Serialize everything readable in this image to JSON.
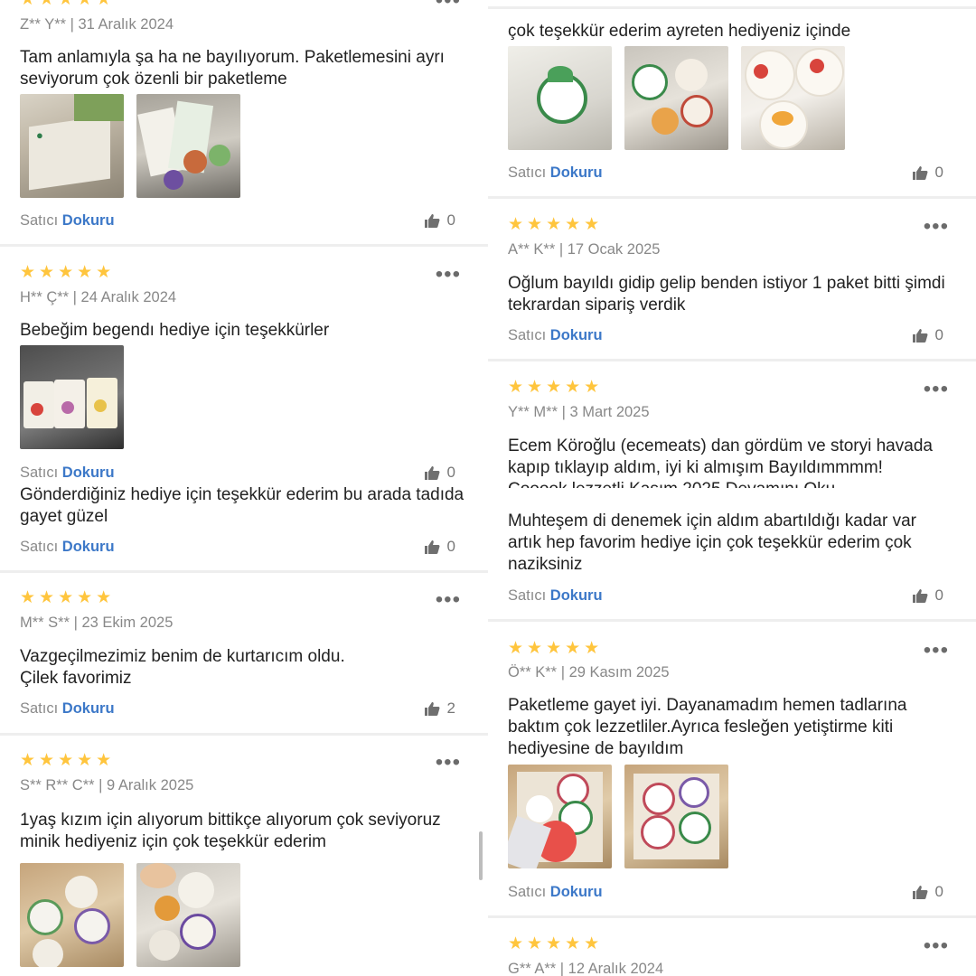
{
  "seller_prefix": "Satıcı",
  "seller_name": "Dokuru",
  "star_glyphs": "★★★★★",
  "more_glyph": "•••",
  "left": [
    {
      "author": "Z** Y** | 31 Aralık 2024",
      "text": "Tam anlamıyla şa ha ne bayılıyorum. Paketlemesini ayrı seviyorum çok özenli bir paketleme",
      "likes": "0",
      "photos": [
        "kraft box with deküru logo",
        "product pouches and stickers"
      ]
    },
    {
      "author": "H** Ç** | 24 Aralık 2024",
      "text": "Bebeğim begendı hediye için teşekkürler",
      "likes": "0",
      "photos": [
        "three fruit snack pouches"
      ]
    },
    {
      "author": "",
      "text": "Gönderdiğiniz hediye için teşekkür ederim bu arada tadıda gayet güzel",
      "likes": "0",
      "photos": []
    },
    {
      "author": "M** S** | 23 Ekim 2025",
      "text": "Vazgeçilmezimiz benim de kurtarıcım oldu. Çilek favorimiz",
      "likes": "2",
      "photos": []
    },
    {
      "author": "S** R** C** | 9 Aralık 2025",
      "text": "1yaş kızım için alıyorum bittikçe alıyorum çok seviyoruz minik hediyeniz için çok teşekkür ederim",
      "likes": "",
      "photos": [
        "box of snack cups",
        "hand holding snack cups"
      ]
    }
  ],
  "right": [
    {
      "author": "",
      "text": "çok teşekkür ederim ayreten hediyeniz içinde",
      "likes": "0",
      "photos": [
        "hediyecik fesleğen kit bag",
        "snack cups in bag",
        "çilek and mango cups"
      ]
    },
    {
      "author": "A** K** | 17 Ocak 2025",
      "text": "Oğlum bayıldı gidip gelip benden istiyor 1 paket bitti şimdi tekrardan sipariş verdik",
      "likes": "0",
      "photos": []
    },
    {
      "author": "Y** M** | 3 Mart 2025",
      "text": "Ecem Köroğlu (ecemeats) dan gördüm ve storyi havada kapıp tıklayıp aldım, iyi ki almışım Bayıldımmmm!",
      "clipped_line": "Cooook lezzetli   Kasım 2025     Devamını Oku",
      "likes": "",
      "photos": []
    },
    {
      "author": "",
      "text": "Muhteşem di denemek için aldım abartıldığı kadar var artık hep favorim hediye için çok teşekkür ederim çok naziksiniz",
      "likes": "0",
      "photos": []
    },
    {
      "author": "Ö** K** | 29 Kasım 2025",
      "text": "Paketleme gayet iyi. Dayanamadım hemen tadlarına baktım çok lezzetliler.Ayrıca fesleğen yetiştirme kiti hediyesine de bayıldım",
      "likes": "0",
      "photos": [
        "cups in box with strawberries",
        "fesleğen cups in box"
      ]
    },
    {
      "author": "G** A** | 12 Aralık 2024",
      "text": "",
      "likes": "",
      "photos": []
    }
  ]
}
